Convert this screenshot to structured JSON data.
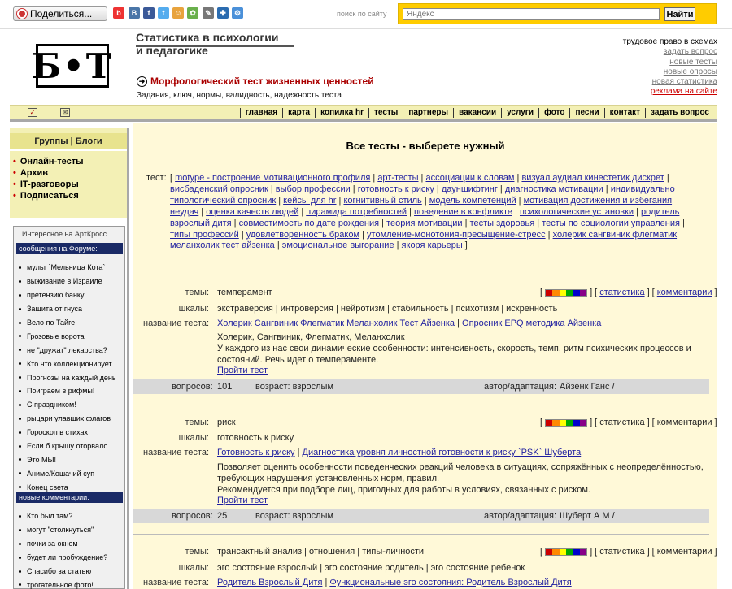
{
  "topbar": {
    "share_label": "Поделиться...",
    "search_label": "поиск по сайту",
    "search_placeholder": "Яндекс",
    "search_button": "Найти",
    "social_icons": [
      "b-icon",
      "vk-icon",
      "facebook-icon",
      "twitter-icon",
      "people-icon",
      "network-icon",
      "pencil-icon",
      "bookmark-icon",
      "gear-icon"
    ]
  },
  "header": {
    "logo": "Б•Т",
    "site_title_1": "Статистика в психологии",
    "site_title_2": "и педагогике",
    "page_heading": "Морфологический тест жизненных ценностей",
    "page_sub": "Задания, ключ, нормы, валидность, надежность теста",
    "right_links": [
      "трудовое право в схемах",
      "задать вопрос",
      "новые тесты",
      "новые опросы",
      "новая статистика",
      "реклама на сайте"
    ]
  },
  "nav": {
    "items": [
      "главная",
      "карта",
      "копилка hr",
      "тесты",
      "партнеры",
      "вакансии",
      "услуги",
      "фото",
      "песни",
      "контакт",
      "задать вопрос"
    ]
  },
  "sidebar": {
    "group_title": "Группы | Блоги",
    "links": [
      "Онлайн-тесты",
      "Архив",
      "IT-разговоры",
      "Подписаться"
    ],
    "art_title": "Интересное на АртКросс",
    "forum_header": "сообщения на Форуме:",
    "forum_items": [
      "мульт `Мельница Кота`",
      "выживание в Израиле",
      "претензию банку",
      "Защита от гнуса",
      "Вело по Тайге",
      "Грозовые ворота",
      "не \"дружат\" лекарства?",
      "Кто что коллекционирует",
      "Прогнозы на каждый день",
      "Поиграем в рифмы!",
      "С праздником!",
      "рыцари улавших флагов",
      "Гороскоп в стихах",
      "Если б крышу оторвало",
      "Это МЫ!",
      "Аниме/Кошачий суп",
      "Конец света"
    ],
    "comments_header": "новые комментарии:",
    "comment_items": [
      "Кто был там?",
      "могут \"столкнуться\"",
      "почки за окном",
      "будет ли пробуждение?",
      "Спасибо за статью",
      "трогательное фото!"
    ]
  },
  "main": {
    "title": "Все тесты - выберете нужный",
    "tests_label": "тест:",
    "tests": [
      "motype - построение мотивационного профиля",
      "арт-тесты",
      "ассоциации к словам",
      "визуал аудиал кинестетик дискрет",
      "висбаденский опросник",
      "выбор профессии",
      "готовность к риску",
      "дауншифтинг",
      "диагностика мотивации",
      "индивидуально типологический опросник",
      "кейсы для hr",
      "когнитивный стиль",
      "модель компетенций",
      "мотивация достижения и избегания неудач",
      "оценка качеств людей",
      "пирамида потребностей",
      "поведение в конфликте",
      "психологические установки",
      "родитель взрослый дитя",
      "совместимость по дате рождения",
      "теория мотивации",
      "тесты здоровья",
      "тесты по социологии управления",
      "типы профессий",
      "удовлетворенность браком",
      "утомление-монотония-пресыщение-стресс",
      "холерик сангвиник флегматик меланхолик тест айзенка",
      "эмоциональное выгорание",
      "якоря карьеры"
    ]
  },
  "labels": {
    "topics": "темы:",
    "scales": "шкалы:",
    "test_name": "название теста:",
    "questions": "вопросов:",
    "author": "автор/адаптация:",
    "statistics": "статистика",
    "comments": "комментарии",
    "take_test": "Пройти тест"
  },
  "entries": [
    {
      "topics": "темперамент",
      "scales": "экстраверсия | интроверсия | нейротизм | стабильность | психотизм | искренность",
      "names": [
        "Холерик Сангвиник Флегматик Меланхолик Тест Айзенка",
        "Опросник EPQ методика Айзенка"
      ],
      "desc_1": "Холерик, Сангвиник, Флегматик, Меланхолик",
      "desc_2": "У каждого из нас свои динамические особенности: интенсивность, скорость, темп, ритм психических процессов и состояний. Речь идет о темпераменте.",
      "questions": "101",
      "age": "возраст: взрослым",
      "author": "Айзенк Ганс /"
    },
    {
      "topics": "риск",
      "scales": "готовность к риску",
      "names": [
        "Готовность к риску",
        "Диагностика уровня личностной готовности к риску `PSK` Шуберта"
      ],
      "desc_1": "Позволяет оценить особенности поведенческих реакций человека в ситуациях, сопряжённых с неопределённостью, требующих нарушения установленных норм, правил.",
      "desc_2": "Рекомендуется при подборе лиц, пригодных для работы в условиях, связанных с риском.",
      "questions": "25",
      "age": "возраст: взрослым",
      "author": "Шуберт А М /"
    },
    {
      "topics": "трансактный анализ | отношения | типы-личности",
      "scales": "эго состояние взрослый | эго состояние родитель | эго состояние ребенок",
      "names": [
        "Родитель Взрослый Дитя",
        "Функциональные эго состояния: Родитель Взрослый Дитя"
      ]
    }
  ]
}
